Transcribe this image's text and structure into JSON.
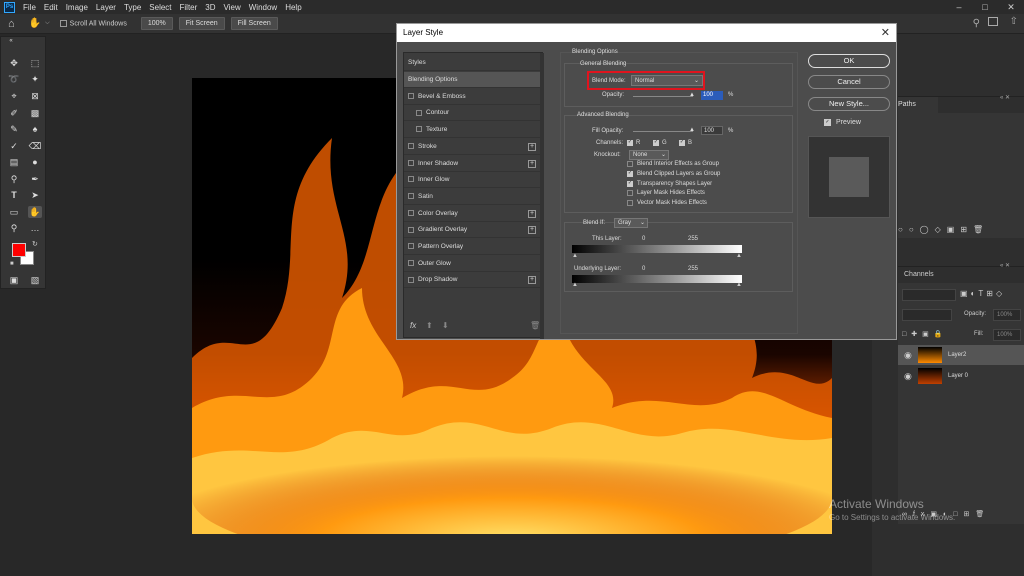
{
  "menu": {
    "app_icon": "Ps",
    "items": [
      "File",
      "Edit",
      "Image",
      "Layer",
      "Type",
      "Select",
      "Filter",
      "3D",
      "View",
      "Window",
      "Help"
    ]
  },
  "options_bar": {
    "scroll_all_windows": "Scroll All Windows",
    "zoom_100": "100%",
    "fit_screen": "Fit Screen",
    "fill_screen": "Fill Screen"
  },
  "dialog": {
    "title": "Layer Style",
    "styles_header": "Styles",
    "style_items": [
      {
        "label": "Blending Options",
        "checkbox": false,
        "plus": false,
        "selected": true
      },
      {
        "label": "Bevel & Emboss",
        "checkbox": true,
        "plus": false
      },
      {
        "label": "Contour",
        "checkbox": true,
        "plus": false,
        "indent": true
      },
      {
        "label": "Texture",
        "checkbox": true,
        "plus": false,
        "indent": true
      },
      {
        "label": "Stroke",
        "checkbox": true,
        "plus": true
      },
      {
        "label": "Inner Shadow",
        "checkbox": true,
        "plus": true
      },
      {
        "label": "Inner Glow",
        "checkbox": true,
        "plus": false
      },
      {
        "label": "Satin",
        "checkbox": true,
        "plus": false
      },
      {
        "label": "Color Overlay",
        "checkbox": true,
        "plus": true
      },
      {
        "label": "Gradient Overlay",
        "checkbox": true,
        "plus": true
      },
      {
        "label": "Pattern Overlay",
        "checkbox": true,
        "plus": false
      },
      {
        "label": "Outer Glow",
        "checkbox": true,
        "plus": false
      },
      {
        "label": "Drop Shadow",
        "checkbox": true,
        "plus": true
      }
    ],
    "fx_label": "fx",
    "blending_options_title": "Blending Options",
    "general_blending": "General Blending",
    "blend_mode_label": "Blend Mode:",
    "blend_mode_value": "Normal",
    "opacity_label": "Opacity:",
    "opacity_value": "100",
    "percent": "%",
    "advanced_blending": "Advanced Blending",
    "fill_opacity_label": "Fill Opacity:",
    "fill_opacity_value": "100",
    "channels_label": "Channels:",
    "channel_r": "R",
    "channel_g": "G",
    "channel_b": "B",
    "knockout_label": "Knockout:",
    "knockout_value": "None",
    "options": [
      {
        "label": "Blend Interior Effects as Group",
        "checked": false
      },
      {
        "label": "Blend Clipped Layers as Group",
        "checked": true
      },
      {
        "label": "Transparency Shapes Layer",
        "checked": true
      },
      {
        "label": "Layer Mask Hides Effects",
        "checked": false
      },
      {
        "label": "Vector Mask Hides Effects",
        "checked": false
      }
    ],
    "blend_if_label": "Blend If:",
    "blend_if_value": "Gray",
    "this_layer_label": "This Layer:",
    "underlying_layer_label": "Underlying Layer:",
    "range_min": "0",
    "range_max": "255",
    "ok": "OK",
    "cancel": "Cancel",
    "new_style": "New Style...",
    "preview": "Preview"
  },
  "right_panels": {
    "paths_tab": "Paths",
    "channels_tab": "Channels",
    "opacity_label": "Opacity:",
    "opacity_value": "100%",
    "fill_label": "Fill:",
    "fill_value": "100%",
    "layers": [
      {
        "name": "Layer2",
        "selected": true
      },
      {
        "name": "Layer 0",
        "selected": false
      }
    ]
  },
  "watermark": {
    "title": "Activate Windows",
    "subtitle": "Go to Settings to activate Windows."
  },
  "colors": {
    "foreground": "#ff0000",
    "background": "#ffffff",
    "highlight": "#e0141e"
  }
}
